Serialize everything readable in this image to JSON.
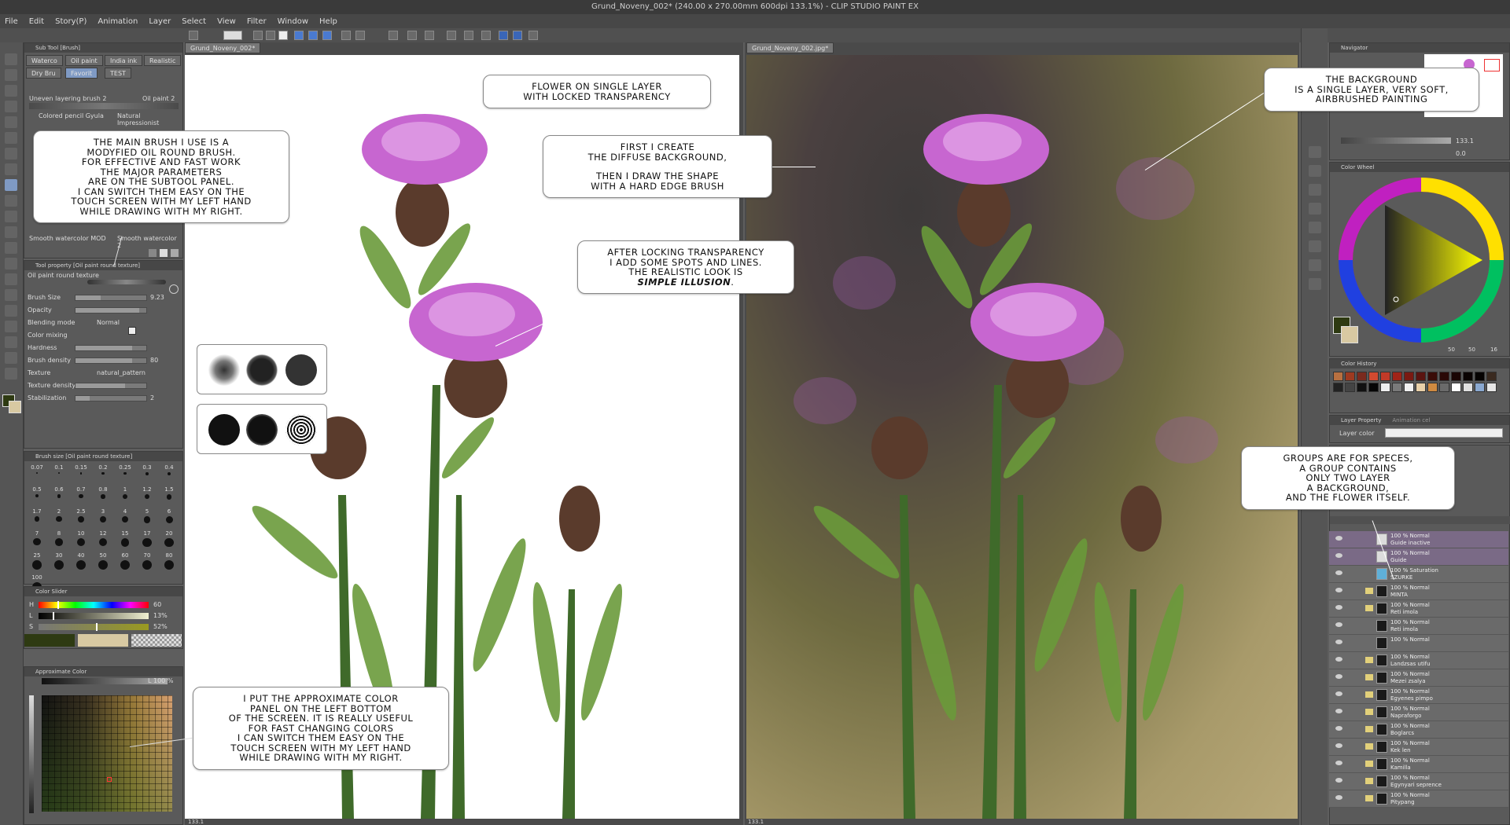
{
  "window": {
    "title": "Grund_Noveny_002* (240.00 x 270.00mm 600dpi 133.1%) - CLIP STUDIO PAINT EX"
  },
  "menu": [
    "File",
    "Edit",
    "Story(P)",
    "Animation",
    "Layer",
    "Select",
    "View",
    "Filter",
    "Window",
    "Help"
  ],
  "subtool": {
    "header": "Sub Tool [Brush]",
    "tabs": [
      "Waterco",
      "Oil paint",
      "India ink",
      "Realistic",
      "Dry Bru",
      "Favorit",
      "TEST"
    ],
    "brushes": [
      "Uneven layering brush 2",
      "Oil paint 2",
      "Colored pencil Gyula",
      "Natural Impressionist",
      "Smooth watercolor MOD",
      "Smooth watercolor 2"
    ]
  },
  "tool_property": {
    "header": "Tool property [Oil paint round texture]",
    "brush_name": "Oil paint round texture",
    "rows": [
      {
        "label": "Brush Size",
        "value": "9.23",
        "fill": 0.35
      },
      {
        "label": "Opacity",
        "value": "",
        "fill": 0.9
      },
      {
        "label": "Blending mode",
        "value": "Normal",
        "fill": 0
      },
      {
        "label": "Color mixing",
        "value": "",
        "fill": 0
      },
      {
        "label": "Hardness",
        "value": "",
        "fill": 0.8
      },
      {
        "label": "Brush density",
        "value": "80",
        "fill": 0.8
      },
      {
        "label": "Texture",
        "value": "natural_pattern",
        "fill": 0
      },
      {
        "label": "Texture density",
        "value": "",
        "fill": 0.7
      },
      {
        "label": "Stabilization",
        "value": "2",
        "fill": 0.2
      }
    ]
  },
  "brush_size_panel": {
    "header": "Brush size [Oil paint round texture]",
    "sizes": [
      "0.07",
      "0.1",
      "0.15",
      "0.2",
      "0.25",
      "0.3",
      "0.4",
      "0.5",
      "0.6",
      "0.7",
      "0.8",
      "1",
      "1.2",
      "1.5",
      "1.7",
      "2",
      "2.5",
      "3",
      "4",
      "5",
      "6",
      "7",
      "8",
      "10",
      "12",
      "15",
      "17",
      "20",
      "25",
      "30",
      "40",
      "50",
      "60",
      "70",
      "80",
      "100"
    ]
  },
  "color_slider": {
    "header": "Color Slider",
    "labels": [
      "H",
      "L",
      "S"
    ],
    "values": [
      "60",
      "13%",
      "52%"
    ],
    "fills": [
      0.17,
      0.13,
      0.52
    ]
  },
  "approx_color": {
    "header": "Approximate Color",
    "l_label": "L 100 %"
  },
  "canvas_left": {
    "tab": "Grund_Noveny_002*",
    "status": "133.1"
  },
  "canvas_right": {
    "tab": "Grund_Noveny_002.jpg*",
    "status": "133.1"
  },
  "bubbles": {
    "flower_single": [
      "FLOWER ON SINGLE LAYER",
      "WITH LOCKED TRANSPARENCY"
    ],
    "diffuse": [
      "FIRST I CREATE",
      "THE DIFFUSE BACKGROUND,",
      "",
      "THEN I DRAW THE SHAPE",
      "WITH A HARD EDGE BRUSH"
    ],
    "locking": [
      "AFTER LOCKING TRANSPARENCY",
      "I ADD SOME SPOTS AND LINES.",
      "THE REALISTIC LOOK IS"
    ],
    "locking_emph": "SIMPLE ILLUSION",
    "main_brush": [
      "THE MAIN BRUSH I USE IS A",
      "MODYFIED OIL ROUND BRUSH.",
      "FOR EFFECTIVE AND FAST WORK",
      "THE MAJOR PARAMETERS",
      "ARE ON THE SUBTOOL PANEL.",
      "I CAN SWITCH THEM EASY ON THE",
      "TOUCH SCREEN WITH MY LEFT HAND",
      "WHILE DRAWING WITH MY RIGHT."
    ],
    "approx": [
      "I PUT THE APPROXIMATE COLOR",
      "PANEL ON THE LEFT BOTTOM",
      "OF THE SCREEN. IT IS REALLY USEFUL",
      "FOR FAST CHANGING COLORS",
      "I CAN SWITCH THEM EASY ON THE",
      "TOUCH SCREEN WITH MY LEFT HAND",
      "WHILE DRAWING WITH MY RIGHT."
    ],
    "background": [
      "THE BACKGROUND",
      "IS A SINGLE LAYER, VERY SOFT,",
      "AIRBRUSHED PAINTING"
    ],
    "groups": [
      "GROUPS ARE FOR SPECES,",
      "A GROUP CONTAINS",
      "ONLY TWO LAYER",
      "A BACKGROUND,",
      "AND THE FLOWER ITSELF."
    ]
  },
  "navigator": {
    "header": "Navigator",
    "zoom": "133.1",
    "rot": "0.0"
  },
  "color_wheel": {
    "header": "Color Wheel",
    "values": [
      "50",
      "50",
      "16"
    ]
  },
  "color_history": {
    "header": "Color History",
    "colors": [
      "#b87040",
      "#9e3a20",
      "#7a2a1e",
      "#d24a30",
      "#c23a28",
      "#a02418",
      "#7a1a12",
      "#5a1410",
      "#3a0c08",
      "#2a0806",
      "#1a0504",
      "#0a0302",
      "#050201",
      "#3a2a20",
      "#222222",
      "#444444",
      "#111111",
      "#050505",
      "#eeeeee",
      "#7a7a7a",
      "#f0f0f0",
      "#e8d0a8",
      "#d08a40",
      "#6a6a6a",
      "#ffffff",
      "#e0e0e0",
      "#8aa8d0",
      "#e6e6e6"
    ]
  },
  "layer_property": {
    "header": "Layer Property",
    "tab2": "Animation cel",
    "layer_color": "Layer color"
  },
  "layers": [
    {
      "mode": "100 % Normal",
      "name": "Guide inactive",
      "kind": "guide"
    },
    {
      "mode": "100 % Normal",
      "name": "Guide",
      "kind": "guide"
    },
    {
      "mode": "100 % Saturation",
      "name": "SZURKE",
      "kind": "adjust"
    },
    {
      "mode": "100 % Normal",
      "name": "MINTA",
      "kind": "folder"
    },
    {
      "mode": "100 % Normal",
      "name": "Reti imola",
      "kind": "folder"
    },
    {
      "mode": "100 % Normal",
      "name": "Reti imola",
      "kind": "layer"
    },
    {
      "mode": "100 % Normal",
      "name": "",
      "kind": "layer"
    },
    {
      "mode": "100 % Normal",
      "name": "Landzsas utifu",
      "kind": "folder"
    },
    {
      "mode": "100 % Normal",
      "name": "Mezei zsalya",
      "kind": "folder"
    },
    {
      "mode": "100 % Normal",
      "name": "Egyenes pimpo",
      "kind": "folder"
    },
    {
      "mode": "100 % Normal",
      "name": "Napraforgo",
      "kind": "folder"
    },
    {
      "mode": "100 % Normal",
      "name": "Boglarcs",
      "kind": "folder"
    },
    {
      "mode": "100 % Normal",
      "name": "Kek len",
      "kind": "folder"
    },
    {
      "mode": "100 % Normal",
      "name": "Kamilla",
      "kind": "folder"
    },
    {
      "mode": "100 % Normal",
      "name": "Egynyari seprence",
      "kind": "folder"
    },
    {
      "mode": "100 % Normal",
      "name": "Pitypang",
      "kind": "folder"
    }
  ]
}
